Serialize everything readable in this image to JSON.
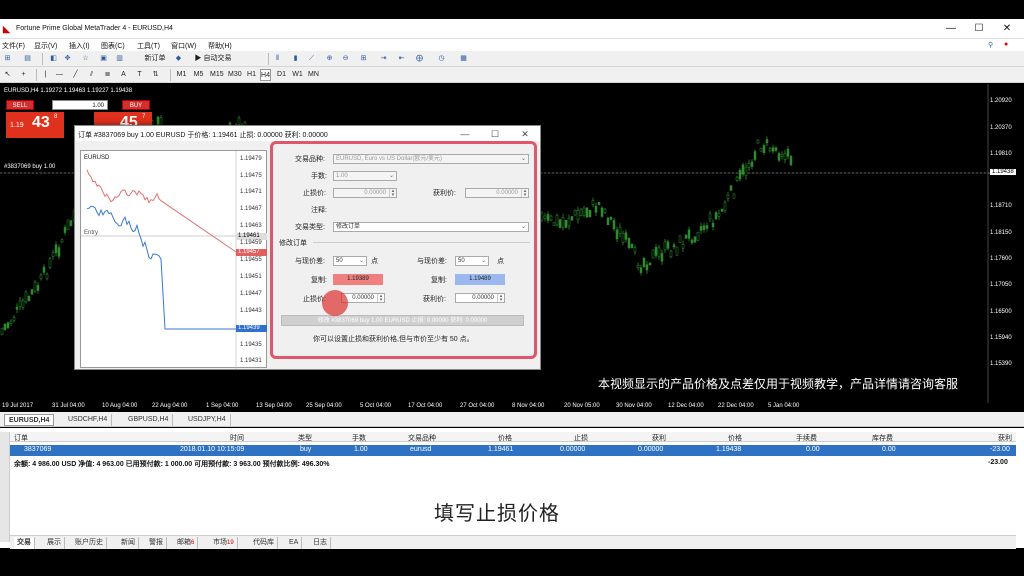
{
  "window": {
    "title": "Fortune Prime Global MetaTrader 4 - EURUSD,H4",
    "minimize": "—",
    "maximize": "☐",
    "close": "✕"
  },
  "menu": [
    "文件(F)",
    "显示(V)",
    "插入(I)",
    "图表(C)",
    "工具(T)",
    "窗口(W)",
    "帮助(H)"
  ],
  "toolbar": {
    "new_order": "新订单",
    "auto_trade": "自动交易",
    "timeframes": [
      "M1",
      "M5",
      "M15",
      "M30",
      "H1",
      "H4",
      "D1",
      "W1",
      "MN"
    ]
  },
  "chart": {
    "header": "EURUSD,H4  1.19272 1.19463 1.19227 1.19438",
    "position_label": "#3837069 buy 1.00",
    "price_axis": [
      "1.20920",
      "1.20370",
      "1.19810",
      "1.19438",
      "1.18710",
      "1.18150",
      "1.17600",
      "1.17050",
      "1.16500",
      "1.15940",
      "1.15390"
    ],
    "time_axis": [
      "19 Jul 2017",
      "31 Jul 04:00",
      "10 Aug 04:00",
      "22 Aug 04:00",
      "1 Sep 04:00",
      "13 Sep 04:00",
      "25 Sep 04:00",
      "5 Oct 04:00",
      "17 Oct 04:00",
      "27 Oct 04:00",
      "8 Nov 04:00",
      "20 Nov 05:00",
      "30 Nov 04:00",
      "12 Dec 04:00",
      "22 Dec 04:00",
      "5 Jan 04:00"
    ],
    "watermark": "本视频显示的产品价格及点差仅用于视频教学，产品详情请咨询客服"
  },
  "trade_panel": {
    "sell": "SELL",
    "buy": "BUY",
    "lot": "1.00",
    "sell_price_main": "43",
    "sell_price_pre": "1.19",
    "sell_price_sup": "8",
    "buy_price_main": "45",
    "buy_price_sup": "7"
  },
  "chart_tabs": [
    "EURUSD,H4",
    "USDCHF,H4",
    "GBPUSD,H4",
    "USDJPY,H4"
  ],
  "dialog": {
    "title": "订单 #3837069 buy 1.00 EURUSD 于价格: 1.19461 止损: 0.00000 获利: 0.00000",
    "mini_ticks": [
      "1.19479",
      "1.19475",
      "1.19471",
      "1.19467",
      "1.19463",
      "1.19459",
      "1.19455",
      "1.19451",
      "1.19447",
      "1.19443",
      "1.19439",
      "1.19435",
      "1.19431"
    ],
    "mini_tag_top": "1.19461",
    "mini_tag_red": "1.19457",
    "mini_tag_blue": "1.19439",
    "mini_chart_label": "EURUSD",
    "entry_label": "Entry",
    "symbol_label": "交易品种:",
    "symbol_value": "EURUSD, Euro vs US Dollar(欧元/美元)",
    "volume_label": "手数:",
    "volume_value": "1.00",
    "sl_label": "止损价:",
    "sl_value": "0.00000",
    "tp_label": "获利价:",
    "tp_value": "0.00000",
    "comment_label": "注释:",
    "type_label": "交易类型:",
    "type_value": "修改订单",
    "modify_section": "修改订单",
    "left_diff_label": "与现价差:",
    "left_diff_value": "50",
    "left_unit": "点",
    "right_diff_label": "与现价差:",
    "right_diff_value": "50",
    "right_unit": "点",
    "copy_label_left": "复制:",
    "copy_value_left": "1.19389",
    "copy_label_right": "复制:",
    "copy_value_right": "1.19489",
    "sl2_label": "止损价:",
    "sl2_value": "0.00000",
    "tp2_label": "获利价:",
    "tp2_value": "0.00000",
    "modify_button": "修改 #3837069 buy 1.00 EURUSD 止损: 0.00000 获利: 0.00000",
    "hint": "你可以设置止损和获利价格,但与市价至少有 50 点。"
  },
  "terminal": {
    "headers": [
      "订单",
      "时间",
      "类型",
      "手数",
      "交易品种",
      "价格",
      "止损",
      "获利",
      "价格",
      "手续费",
      "库存费",
      "获利"
    ],
    "row": [
      "3837069",
      "2018.01.10 10:15:09",
      "buy",
      "1.00",
      "eurusd",
      "1.19461",
      "0.00000",
      "0.00000",
      "1.19438",
      "0.00",
      "0.00",
      "-23.00"
    ],
    "balance_text": "余额: 4 986.00 USD  净值: 4 963.00  已用预付款: 1 000.00  可用预付款: 3 963.00  预付款比例: 496.30%",
    "balance_profit": "-23.00",
    "tabs": [
      "交易",
      "展示",
      "账户历史",
      "新闻",
      "警报",
      "邮箱",
      "市场",
      "代码库",
      "EA",
      "日志"
    ],
    "mail_badge": "6",
    "market_badge": "19"
  },
  "subtitle": "填写止损价格",
  "colors": {
    "bull": "#2e8b2e",
    "bear": "#000000",
    "sell_red": "#e0301e",
    "highlight_blue": "#2f72c4",
    "dialog_border": "#e0566a"
  }
}
